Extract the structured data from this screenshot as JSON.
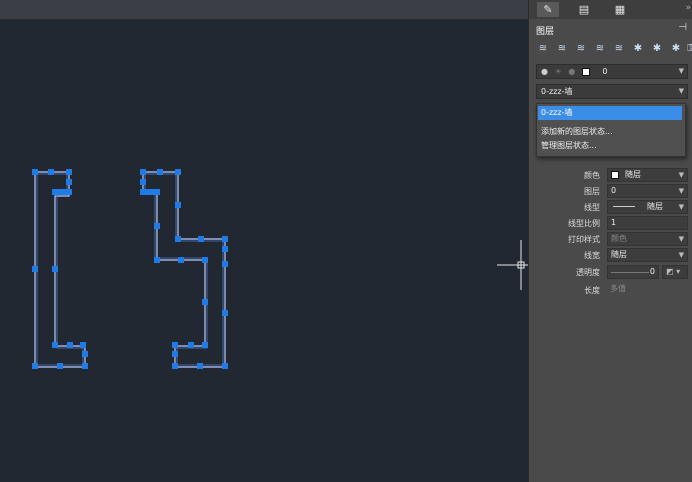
{
  "panel": {
    "title": "图层",
    "tabs": [
      "properties-tab",
      "layers-tab",
      "blocks-tab"
    ],
    "layer_row": {
      "value": "0"
    },
    "layer_dropdown": {
      "value": "0-zzz-墙"
    },
    "popup": {
      "selected": "0-zzz-墙",
      "items": [
        "添加新的图层状态...",
        "管理图层状态..."
      ]
    },
    "props": [
      {
        "label": "颜色",
        "value": "随层",
        "kind": "color"
      },
      {
        "label": "图层",
        "value": "0",
        "kind": "dd"
      },
      {
        "label": "线型",
        "value": "随层",
        "kind": "linetype"
      },
      {
        "label": "线型比例",
        "value": "1",
        "kind": "text"
      },
      {
        "label": "打印样式",
        "value": "颜色",
        "kind": "dim"
      },
      {
        "label": "线宽",
        "value": "随层",
        "kind": "dd"
      },
      {
        "label": "透明度",
        "value": "0",
        "kind": "slider"
      },
      {
        "label": "长度",
        "value": "多值",
        "kind": "plain"
      }
    ]
  },
  "colors": {
    "canvas_bg": "#222831",
    "selection": "#1e7be8",
    "highlight": "#3b8ee8"
  }
}
